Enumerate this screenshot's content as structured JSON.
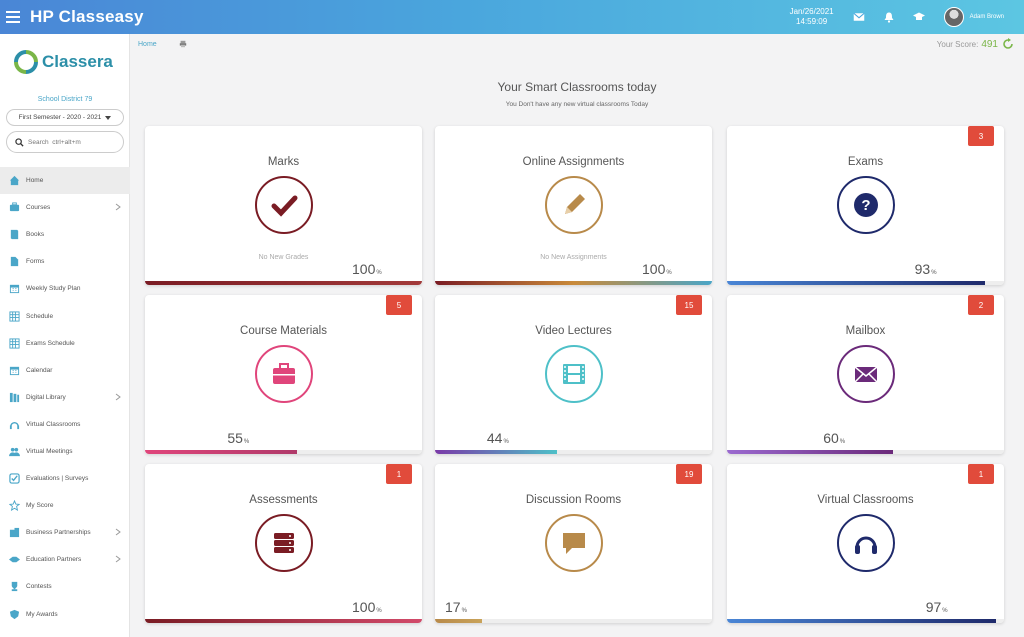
{
  "app": {
    "title": "HP Classeasy"
  },
  "header": {
    "date": "Jan/26/2021",
    "time": "14:59:09",
    "user": "Adam Brown"
  },
  "sidebar": {
    "logo_text": "Classera",
    "district": "School District 79",
    "semester": "First Semester - 2020 - 2021",
    "search_placeholder": "Search  ctrl+alt+m",
    "items": [
      {
        "label": "Home",
        "icon": "home-icon",
        "active": true,
        "chevron": false
      },
      {
        "label": "Courses",
        "icon": "briefcase-icon",
        "chevron": true
      },
      {
        "label": "Books",
        "icon": "book-icon",
        "chevron": false
      },
      {
        "label": "Forms",
        "icon": "file-icon",
        "chevron": false
      },
      {
        "label": "Weekly Study Plan",
        "icon": "calendar-icon",
        "chevron": false
      },
      {
        "label": "Schedule",
        "icon": "table-icon",
        "chevron": false
      },
      {
        "label": "Exams Schedule",
        "icon": "table-icon",
        "chevron": false
      },
      {
        "label": "Calendar",
        "icon": "calendar-icon",
        "chevron": false
      },
      {
        "label": "Digital Library",
        "icon": "library-icon",
        "chevron": true
      },
      {
        "label": "Virtual Classrooms",
        "icon": "headphones-icon",
        "chevron": false
      },
      {
        "label": "Virtual Meetings",
        "icon": "users-icon",
        "chevron": false
      },
      {
        "label": "Evaluations | Surveys",
        "icon": "checkbox-icon",
        "chevron": false
      },
      {
        "label": "My Score",
        "icon": "star-icon",
        "chevron": false
      },
      {
        "label": "Business Partnerships",
        "icon": "building-icon",
        "chevron": true
      },
      {
        "label": "Education Partners",
        "icon": "handshake-icon",
        "chevron": true
      },
      {
        "label": "Contests",
        "icon": "trophy-icon",
        "chevron": false
      },
      {
        "label": "My Awards",
        "icon": "shield-icon",
        "chevron": false
      }
    ]
  },
  "breadcrumb": {
    "home": "Home"
  },
  "score": {
    "label": "Your Score:",
    "value": "491"
  },
  "main": {
    "heading": "Your Smart Classrooms today",
    "subheading": "You Don't have any new virtual classrooms Today",
    "cards": [
      {
        "title": "Marks",
        "icon": "checkmark-icon",
        "color": "#7a1c24",
        "badge": "",
        "sub": "No New Grades",
        "percent": 100,
        "pct_label": "100",
        "bar": "linear-gradient(90deg,#7a1c24,#a23a3a)"
      },
      {
        "title": "Online Assignments",
        "icon": "pencil-icon",
        "color": "#b88a4a",
        "badge": "",
        "sub": "No New Assignments",
        "percent": 100,
        "pct_label": "100",
        "bar": "linear-gradient(90deg,#7a1c24,#c98a3a,#4aa6c8)"
      },
      {
        "title": "Exams",
        "icon": "question-icon",
        "color": "#1f2a6b",
        "badge": "3",
        "sub": "",
        "percent": 93,
        "pct_label": "93",
        "bar": "linear-gradient(90deg,#4a86d6,#1f2a6b)"
      },
      {
        "title": "Course Materials",
        "icon": "briefcase-icon",
        "color": "#e0457b",
        "badge": "5",
        "sub": "",
        "percent": 55,
        "pct_label": "55",
        "bar": "linear-gradient(90deg,#e0457b,#b03a6a)"
      },
      {
        "title": "Video Lectures",
        "icon": "film-icon",
        "color": "#4ec0c8",
        "badge": "15",
        "sub": "",
        "percent": 44,
        "pct_label": "44",
        "bar": "linear-gradient(90deg,#7a3aa8,#4ec0c8)"
      },
      {
        "title": "Mailbox",
        "icon": "envelope-icon",
        "color": "#6b2a7a",
        "badge": "2",
        "sub": "",
        "percent": 60,
        "pct_label": "60",
        "bar": "linear-gradient(90deg,#9b6ad0,#6b2a7a)"
      },
      {
        "title": "Assessments",
        "icon": "server-icon",
        "color": "#7a1c24",
        "badge": "1",
        "sub": "",
        "percent": 100,
        "pct_label": "100",
        "bar": "linear-gradient(90deg,#7a1c24,#d24a6a)"
      },
      {
        "title": "Discussion Rooms",
        "icon": "comment-icon",
        "color": "#b88a4a",
        "badge": "19",
        "sub": "",
        "percent": 17,
        "pct_label": "17",
        "bar": "linear-gradient(90deg,#b88a4a,#c9a35a)"
      },
      {
        "title": "Virtual Classrooms",
        "icon": "headphones-icon",
        "color": "#1f2a6b",
        "badge": "1",
        "sub": "",
        "percent": 97,
        "pct_label": "97",
        "bar": "linear-gradient(90deg,#4a86d6,#1f2a6b)"
      }
    ]
  }
}
